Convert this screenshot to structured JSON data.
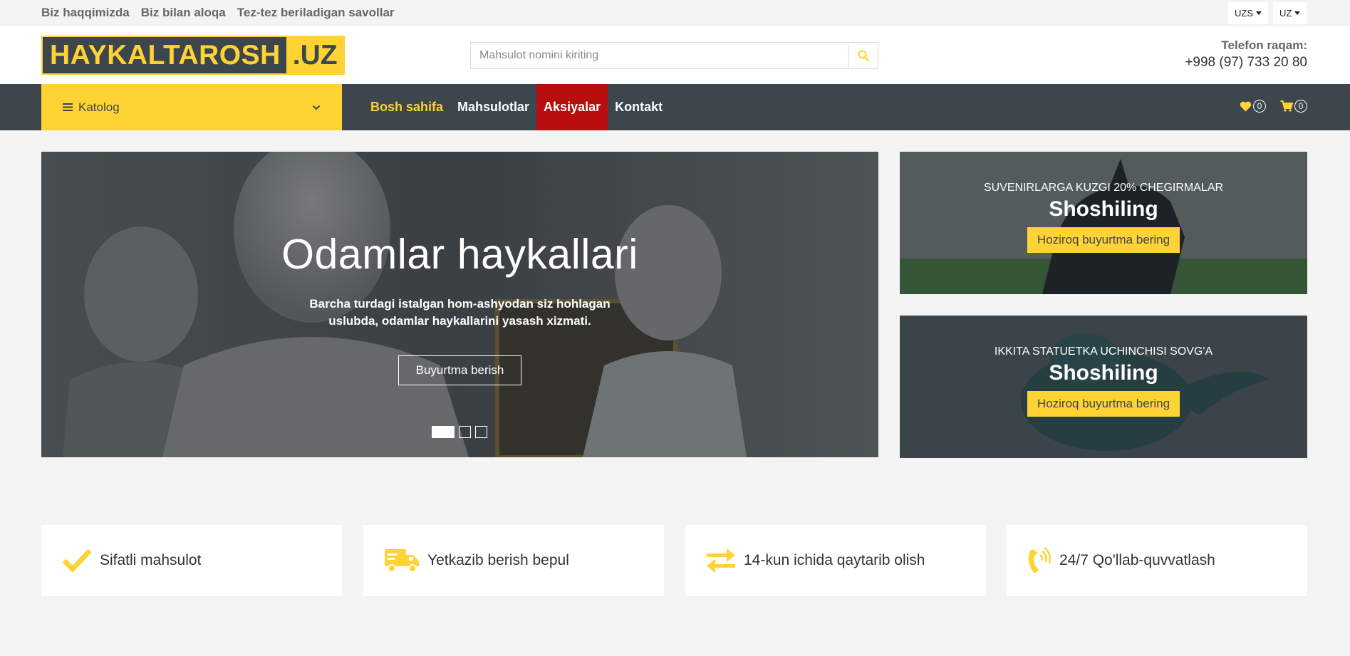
{
  "topbar": {
    "links": [
      "Biz haqqimizda",
      "Biz bilan aloqa",
      "Tez-tez beriladigan savollar"
    ],
    "currency": "UZS",
    "language": "UZ"
  },
  "header": {
    "logo_part1": "HAYKALTAROSH",
    "logo_part2": ".UZ",
    "search_placeholder": "Mahsulot nomini kiriting",
    "phone_label": "Telefon raqam:",
    "phone_number": "+998 (97) 733 20 80"
  },
  "nav": {
    "catalog_label": "Katolog",
    "items": [
      "Bosh sahifa",
      "Mahsulotlar",
      "Aksiyalar",
      "Kontakt"
    ],
    "wishlist_count": "0",
    "cart_count": "0"
  },
  "hero": {
    "title": "Odamlar haykallari",
    "subtitle": "Barcha turdagi istalgan hom-ashyodan siz hohlagan uslubda, odamlar haykallarini yasash xizmati.",
    "button": "Buyurtma berish",
    "active_slide": 1,
    "slide_count": 3
  },
  "promos": [
    {
      "small": "SUVENIRLARGA KUZGI 20% CHEGIRMALAR",
      "big": "Shoshiling",
      "button": "Hoziroq buyurtma bering"
    },
    {
      "small": "IKKITA STATUETKA UCHINCHISI SOVG'A",
      "big": "Shoshiling",
      "button": "Hoziroq buyurtma bering"
    }
  ],
  "features": [
    {
      "icon": "check-icon",
      "label": "Sifatli mahsulot"
    },
    {
      "icon": "truck-icon",
      "label": "Yetkazib berish bepul"
    },
    {
      "icon": "exchange-icon",
      "label": "14-kun ichida qaytarib olish"
    },
    {
      "icon": "phone-volume-icon",
      "label": "24/7 Qo'llab-quvvatlash"
    }
  ],
  "colors": {
    "accent": "#ffd333",
    "dark": "#3d464d",
    "sale": "#b90e0e"
  }
}
